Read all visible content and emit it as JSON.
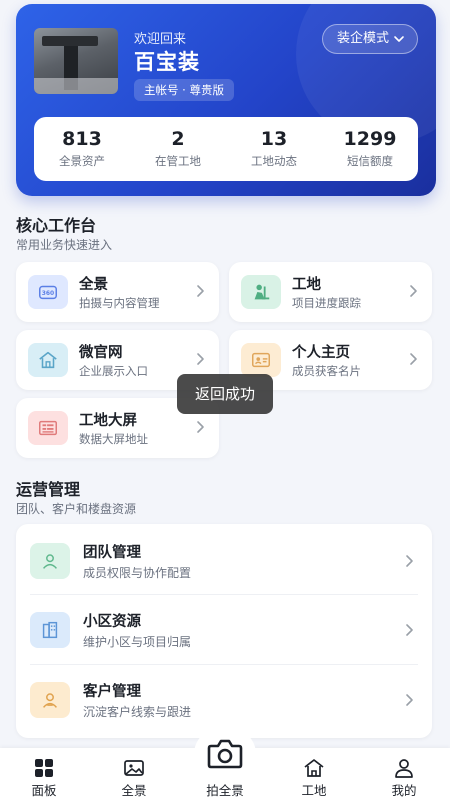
{
  "header": {
    "welcome": "欢迎回来",
    "company": "百宝装",
    "badge": "主帐号 · 尊贵版",
    "mode_button": "装企模式",
    "stats": [
      {
        "value": "813",
        "label": "全景资产"
      },
      {
        "value": "2",
        "label": "在管工地"
      },
      {
        "value": "13",
        "label": "工地动态"
      },
      {
        "value": "1299",
        "label": "短信额度"
      }
    ]
  },
  "core": {
    "title": "核心工作台",
    "subtitle": "常用业务快速进入",
    "items": [
      {
        "title": "全景",
        "desc": "拍摄与内容管理",
        "icon": "panorama-360-icon"
      },
      {
        "title": "工地",
        "desc": "项目进度跟踪",
        "icon": "construction-worker-icon"
      },
      {
        "title": "微官网",
        "desc": "企业展示入口",
        "icon": "home-icon"
      },
      {
        "title": "个人主页",
        "desc": "成员获客名片",
        "icon": "profile-card-icon"
      },
      {
        "title": "工地大屏",
        "desc": "数据大屏地址",
        "icon": "data-screen-icon"
      }
    ]
  },
  "operations": {
    "title": "运营管理",
    "subtitle": "团队、客户和楼盘资源",
    "items": [
      {
        "title": "团队管理",
        "desc": "成员权限与协作配置",
        "icon": "team-icon"
      },
      {
        "title": "小区资源",
        "desc": "维护小区与项目归属",
        "icon": "building-icon"
      },
      {
        "title": "客户管理",
        "desc": "沉淀客户线索与跟进",
        "icon": "customer-icon"
      }
    ]
  },
  "toast": "返回成功",
  "nav": {
    "items": [
      {
        "label": "面板",
        "icon": "dashboard-grid-icon"
      },
      {
        "label": "全景",
        "icon": "image-icon"
      },
      {
        "label": "拍全景",
        "icon": "camera-icon"
      },
      {
        "label": "工地",
        "icon": "home-icon"
      },
      {
        "label": "我的",
        "icon": "user-icon"
      }
    ]
  },
  "colors": {
    "brand_blue": "#2e63e8",
    "brand_dark": "#1a2f9e",
    "page_bg": "#f3f5fa"
  }
}
